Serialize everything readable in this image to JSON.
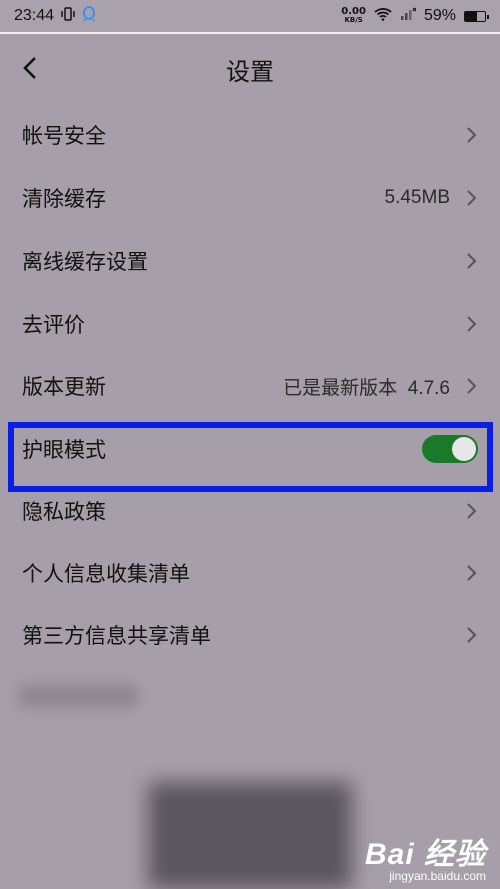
{
  "status": {
    "time": "23:44",
    "net_speed": "0.00",
    "net_unit": "KB/S",
    "battery": "59%",
    "battery_level": 0.59
  },
  "header": {
    "title": "设置"
  },
  "settings": [
    {
      "label": "帐号安全",
      "value": ""
    },
    {
      "label": "清除缓存",
      "value": "5.45MB"
    },
    {
      "label": "离线缓存设置",
      "value": ""
    },
    {
      "label": "去评价",
      "value": ""
    },
    {
      "label": "版本更新",
      "value": "已是最新版本  4.7.6"
    },
    {
      "label": "护眼模式",
      "toggle": true
    },
    {
      "label": "隐私政策",
      "value": ""
    },
    {
      "label": "个人信息收集清单",
      "value": ""
    },
    {
      "label": "第三方信息共享清单",
      "value": ""
    }
  ],
  "watermark": {
    "brand": "Bai 经验",
    "site": "jingyan.baidu.com"
  },
  "colors": {
    "highlight": "#0a1ee6",
    "toggle_on": "#1a7a2a"
  }
}
